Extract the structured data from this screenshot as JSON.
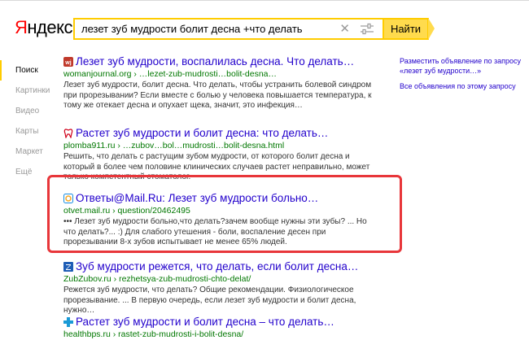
{
  "logo": {
    "first_letter": "Я",
    "rest": "ндекс"
  },
  "search": {
    "query": "лезет зуб мудрости болит десна +что делать",
    "button_label": "Найти"
  },
  "sidebar": {
    "items": [
      {
        "label": "Поиск",
        "active": true
      },
      {
        "label": "Картинки"
      },
      {
        "label": "Видео"
      },
      {
        "label": "Карты"
      },
      {
        "label": "Маркет"
      },
      {
        "label": "Ещё"
      }
    ]
  },
  "results": [
    {
      "title": "Лезет зуб мудрости, воспалилась десна. Что делать…",
      "url": "womanjournal.org › …lezet-zub-mudrosti…bolit-desna…",
      "snippet": "Лезет зуб мудрости, болит десна. Что делать, чтобы устранить болевой синдром при прорезывании? Если вместе с болью у человека повышается температура, к тому же отекает десна и опухает щека, значит, это инфекция…"
    },
    {
      "title": "Растет зуб мудрости и болит десна: что делать…",
      "url": "plomba911.ru › …zubov…bol…mudrosti…bolit-desna.html",
      "snippet": "Решить, что делать с растущим зубом мудрости, от которого болит десна и который в более чем половине клинических случаев растет неправильно, может только компетентный стоматолог."
    },
    {
      "title": "Ответы@Mail.Ru: Лезет зуб мудрости больно…",
      "url": "otvet.mail.ru › question/20462495",
      "snippet": "••• Лезет зуб мудрости больно,что делать?зачем вообще нужны эти зубы? ... Но что делать?... :) Для слабого утешения - боли, воспаление десен при прорезывании 8-х зубов испытывает не менее 65% людей."
    },
    {
      "title": "Зуб мудрости режется, что делать, если болит десна…",
      "url": "ZubZubov.ru › rezhetsya-zub-mudrosti-chto-delat/",
      "snippet": "Режется зуб мудрости, что делать? Общие рекомендации. Физиологическое прорезывание. ... В первую очередь, если лезет зуб мудрости и болит десна, нужно…"
    },
    {
      "title": "Растет зуб мудрости и болит десна – что делать…",
      "url": "healthbps.ru › rastet-zub-mudrosti-i-bolit-desna/"
    }
  ],
  "right": {
    "ad_link": "Разместить объявление по запросу «лезет зуб мудрости…»",
    "all_ads_link": "Все объявления по этому запросу"
  },
  "colors": {
    "accent": "#ffdb4d",
    "link": "#2200cc",
    "url": "#007700",
    "highlight": "#e8363a",
    "logo_red": "#ff0000"
  }
}
